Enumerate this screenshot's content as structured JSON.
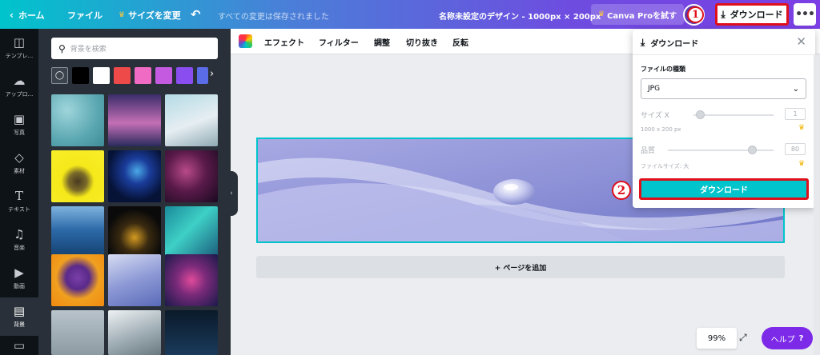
{
  "topbar": {
    "home": "ホーム",
    "file": "ファイル",
    "resize": "サイズを変更",
    "saved": "すべての変更は保存されました",
    "title": "名称未設定のデザイン - 1000px × 200px",
    "pro": "Canva Proを試す",
    "avatar": "R",
    "download": "ダウンロード",
    "more": "•••"
  },
  "badges": {
    "one": "1",
    "two": "2"
  },
  "rail": [
    {
      "label": "テンプレ...",
      "icon": "template-icon"
    },
    {
      "label": "アップロ...",
      "icon": "upload-icon"
    },
    {
      "label": "写真",
      "icon": "photo-icon"
    },
    {
      "label": "素材",
      "icon": "elements-icon"
    },
    {
      "label": "テキスト",
      "icon": "text-icon"
    },
    {
      "label": "音楽",
      "icon": "music-icon"
    },
    {
      "label": "動画",
      "icon": "video-icon"
    },
    {
      "label": "背景",
      "icon": "background-icon"
    }
  ],
  "panel": {
    "search_placeholder": "背景を検索",
    "swatches": [
      "#000000",
      "#ffffff",
      "#ef4a4a",
      "#f06bc4",
      "#c45ae0",
      "#8a4ef0",
      "#5a6ce8"
    ]
  },
  "toolbar": {
    "effects": "エフェクト",
    "filter": "フィルター",
    "adjust": "調整",
    "crop": "切り抜き",
    "flip": "反転",
    "info": "i"
  },
  "canvas": {
    "add_page": "+ ページを追加"
  },
  "download_panel": {
    "title": "ダウンロード",
    "file_type_label": "ファイルの種類",
    "file_type_value": "JPG",
    "size_label": "サイズ X",
    "size_value": "1",
    "size_note": "1000 x 200 px",
    "quality_label": "品質",
    "quality_value": "80",
    "file_size_note": "ファイルサイズ: 大",
    "button": "ダウンロード"
  },
  "zoom": "99%",
  "help": {
    "label": "ヘルプ",
    "mark": "?"
  }
}
